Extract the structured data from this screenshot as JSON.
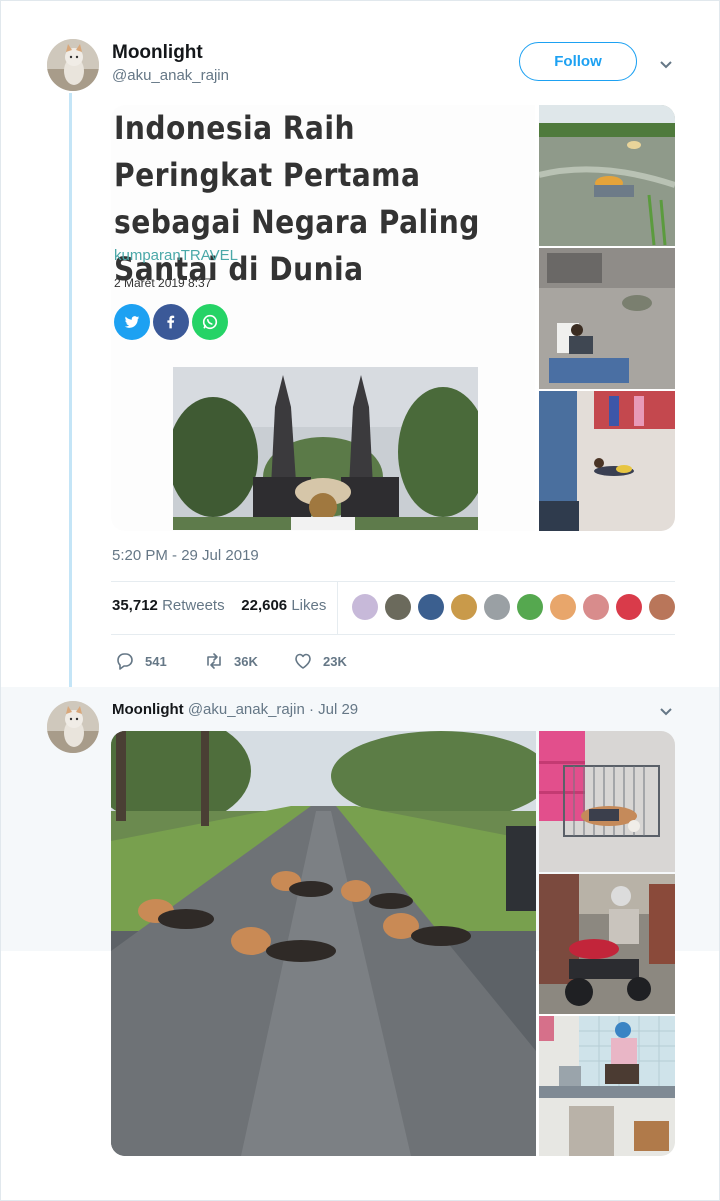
{
  "tweet1": {
    "name": "Moonlight",
    "handle": "@aku_anak_rajin",
    "follow_label": "Follow",
    "article": {
      "headline": "Indonesia Raih Peringkat Pertama sebagai Negara Paling Santai di Dunia",
      "source": "kumparanTRAVEL",
      "date": "2 Maret 2019 8:37"
    },
    "timestamp": "5:20 PM - 29 Jul 2019",
    "retweets_count": "35,712",
    "retweets_label": "Retweets",
    "likes_count": "22,606",
    "likes_label": "Likes",
    "replies": "541",
    "retweets_short": "36K",
    "likes_short": "23K"
  },
  "tweet2": {
    "name": "Moonlight",
    "handle": "@aku_anak_rajin",
    "separator": "·",
    "date": "Jul 29"
  },
  "colors": {
    "accent": "#1da1f2",
    "thread_line": "#c4e5f7",
    "muted": "#657786"
  },
  "icons": [
    "chevron-down-icon",
    "reply-icon",
    "retweet-icon",
    "like-icon",
    "twitter-share-icon",
    "facebook-share-icon",
    "whatsapp-share-icon"
  ]
}
